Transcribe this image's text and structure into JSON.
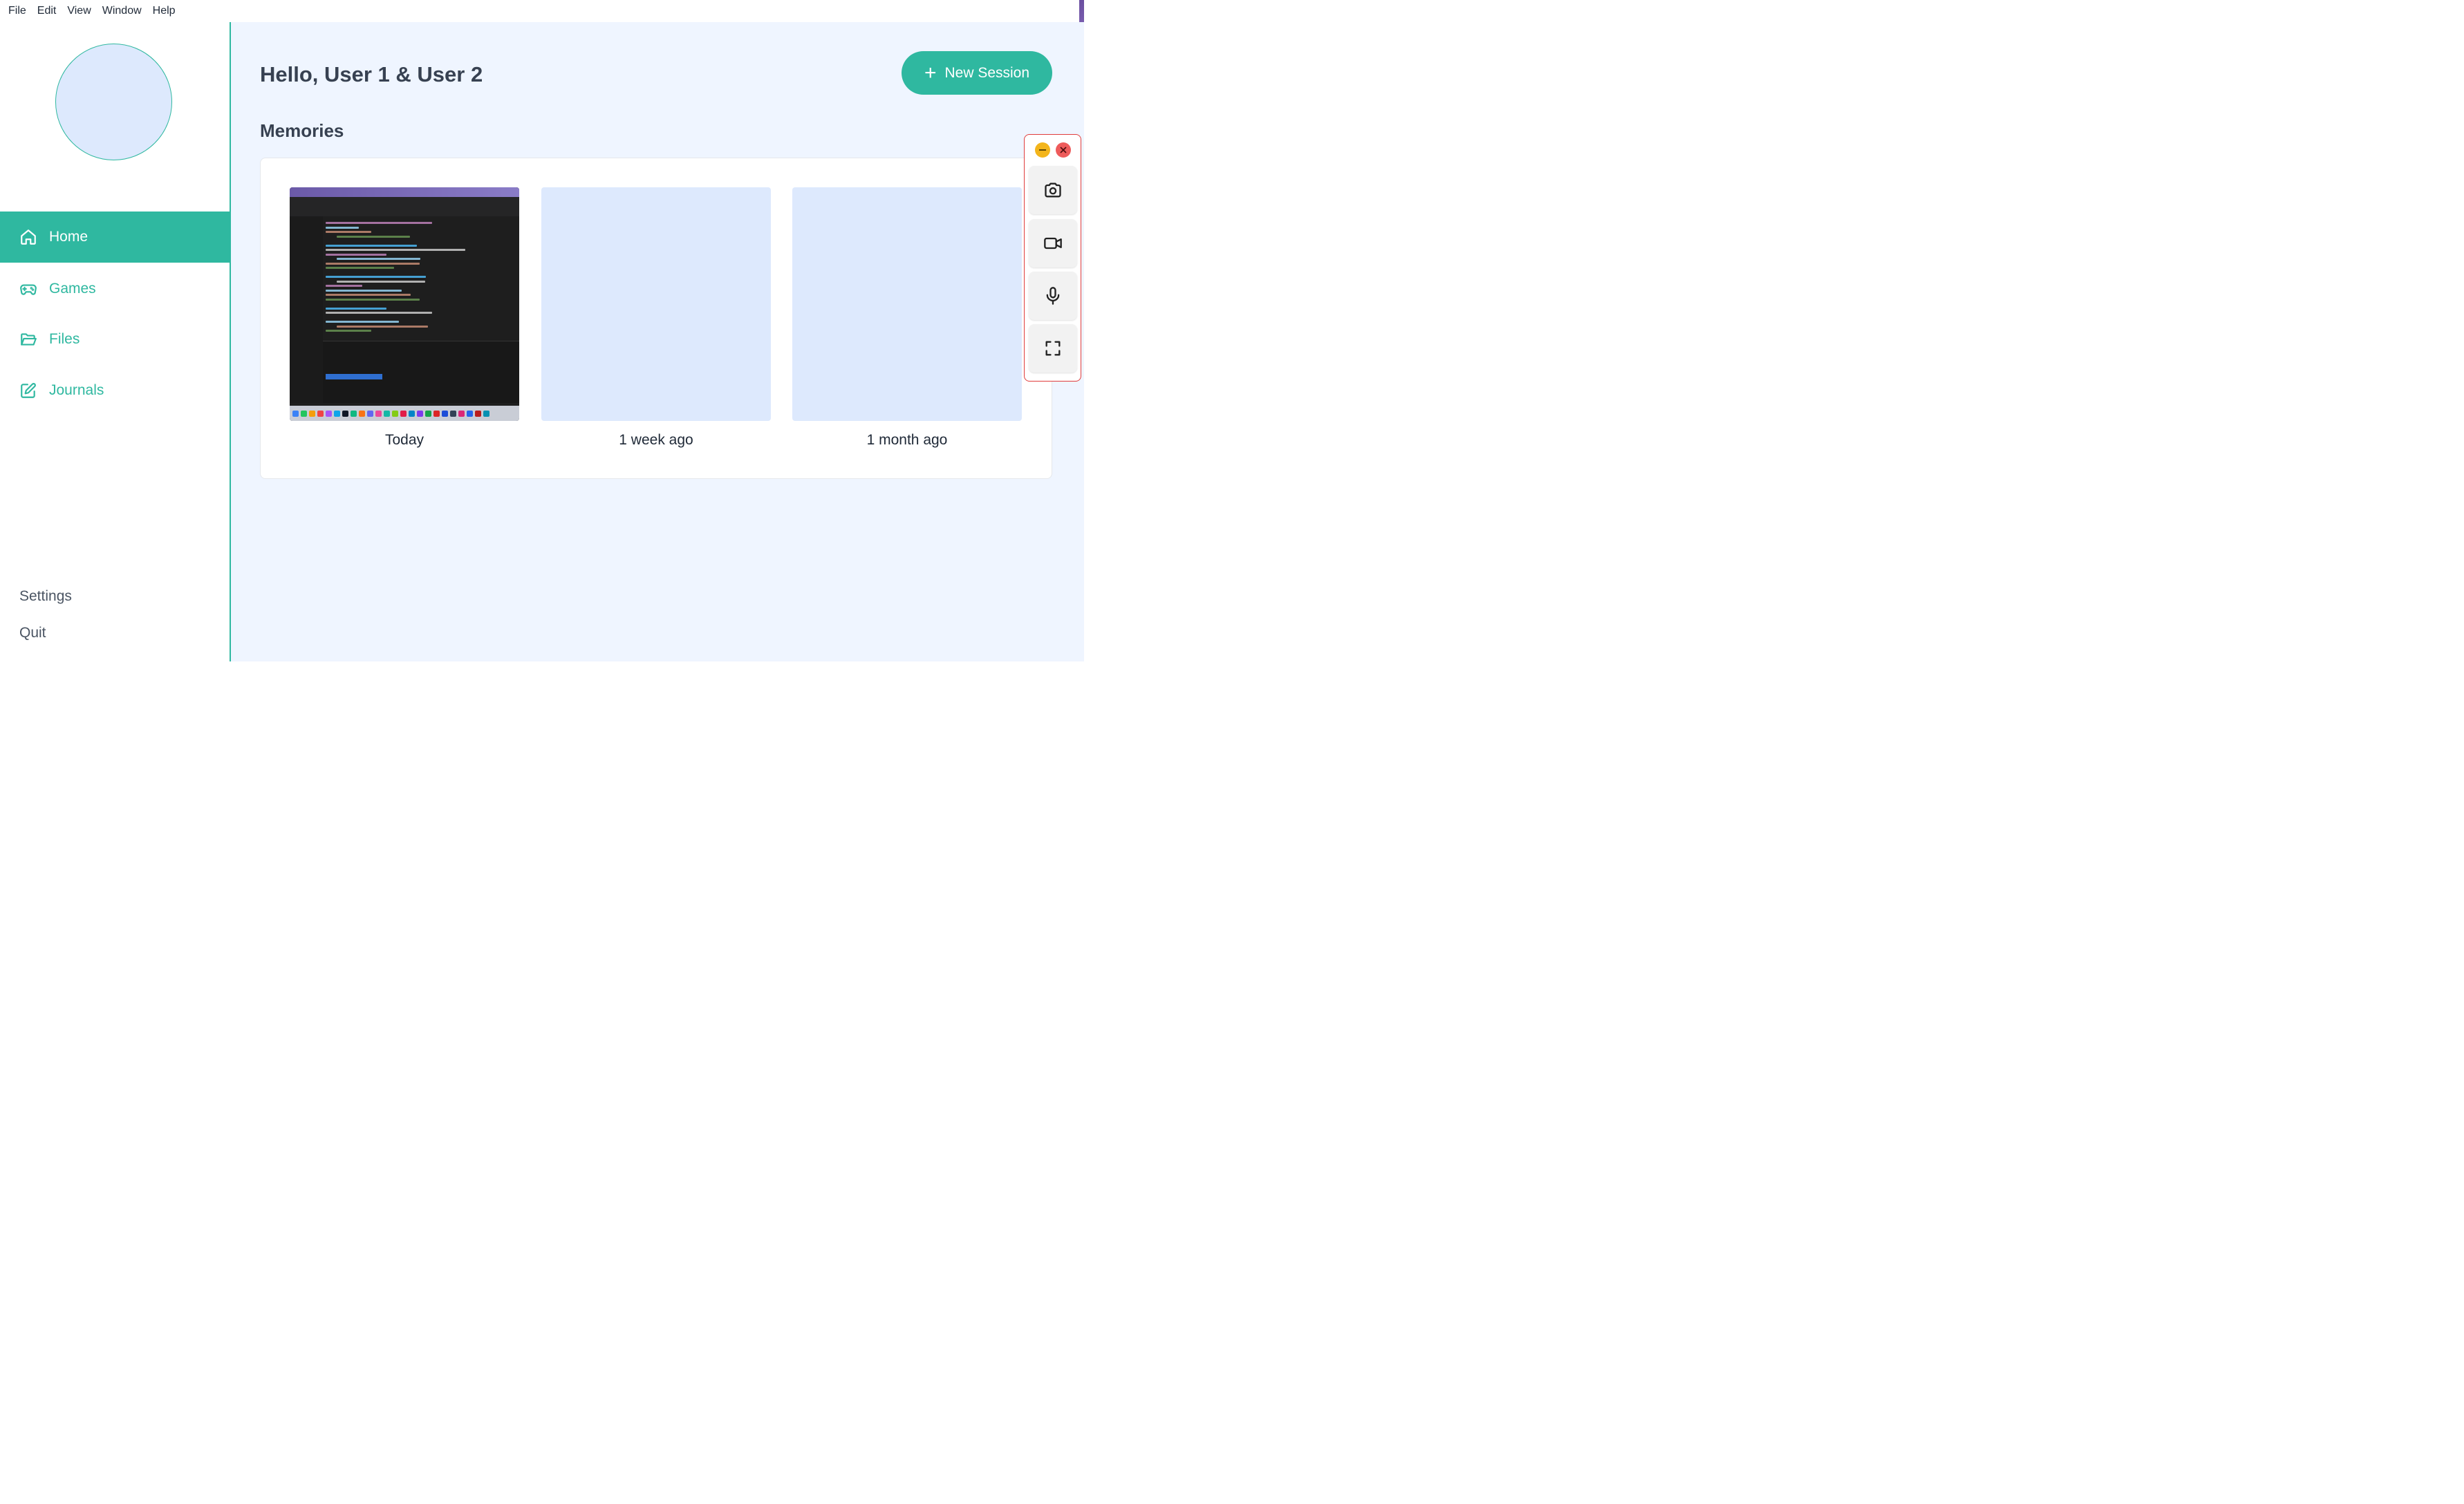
{
  "menubar": {
    "items": [
      "File",
      "Edit",
      "View",
      "Window",
      "Help"
    ]
  },
  "sidebar": {
    "nav": [
      {
        "label": "Home",
        "icon": "home-icon",
        "active": true
      },
      {
        "label": "Games",
        "icon": "gamepad-icon",
        "active": false
      },
      {
        "label": "Files",
        "icon": "folder-icon",
        "active": false
      },
      {
        "label": "Journals",
        "icon": "edit-icon",
        "active": false
      }
    ],
    "settings_label": "Settings",
    "quit_label": "Quit"
  },
  "main": {
    "greeting": "Hello, User 1 & User 2",
    "new_session_label": "New Session",
    "memories_title": "Memories",
    "memories": [
      {
        "caption": "Today",
        "has_image": true
      },
      {
        "caption": "1 week ago",
        "has_image": false
      },
      {
        "caption": "1 month ago",
        "has_image": false
      }
    ]
  },
  "toolbar": {
    "buttons": [
      "camera-icon",
      "video-icon",
      "microphone-icon",
      "fullscreen-icon"
    ]
  },
  "colors": {
    "accent": "#2fb8a0",
    "main_bg": "#eff5ff",
    "placeholder": "#dde9fd",
    "close": "#ee5b5b",
    "minimize": "#f3b51b",
    "panel_border": "#e03c3c"
  }
}
